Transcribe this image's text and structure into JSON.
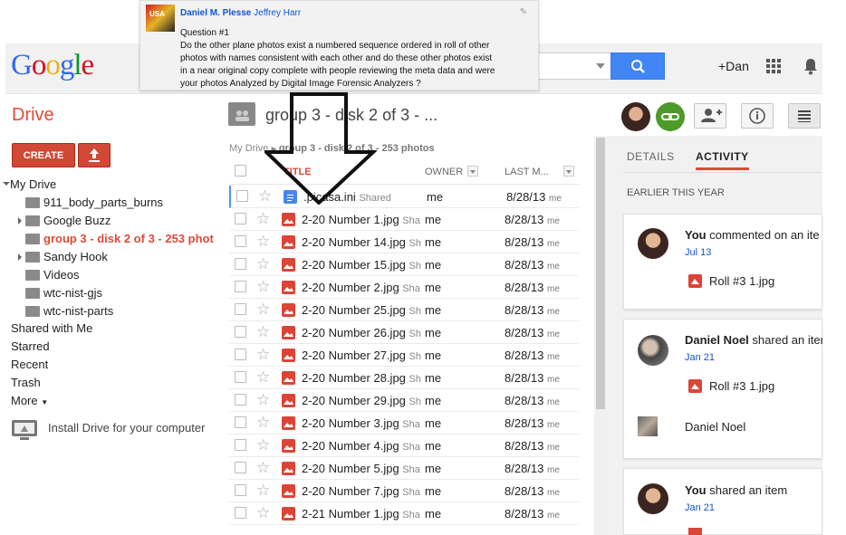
{
  "popup": {
    "author": "Daniel M. Plesse",
    "mention": "Jeffrey Harr",
    "lines": [
      "Question #1",
      "Do the other plane photos exist a numbered sequence ordered in roll of other",
      "photos with names consistent with each other and do these other photos exist",
      "in a near original copy complete with people reviewing the meta data and were",
      "your photos Analyzed by Digital Image Forensic Analyzers ?"
    ]
  },
  "header": {
    "logo_letters": [
      "G",
      "o",
      "o",
      "g",
      "l",
      "e"
    ],
    "logo_colors": [
      "#3369e8",
      "#d50f25",
      "#eeb211",
      "#3369e8",
      "#009925",
      "#d50f25"
    ],
    "user": "+Dan"
  },
  "drive": {
    "title": "Drive",
    "folder_title": "group 3 - disk 2 of 3 - ...",
    "create_label": "CREATE"
  },
  "nav": {
    "my_drive": "My Drive",
    "folders": [
      "911_body_parts_burns",
      "Google Buzz",
      "group 3 - disk 2 of 3 - 253 phot",
      "Sandy Hook",
      "Videos",
      "wtc-nist-gjs",
      "wtc-nist-parts"
    ],
    "shared": "Shared with Me",
    "starred": "Starred",
    "recent": "Recent",
    "trash": "Trash",
    "more": "More",
    "install": "Install Drive for your computer"
  },
  "list": {
    "breadcrumb_root": "My Drive",
    "breadcrumb_current": "group 3 - disk 2 of 3 - 253 photos",
    "col_title": "TITLE",
    "col_owner": "OWNER",
    "col_modified": "LAST M...",
    "rows": [
      {
        "name": ".picasa.ini",
        "shared": "Shared",
        "owner": "me",
        "date": "8/28/13",
        "by": "me",
        "type": "doc"
      },
      {
        "name": "2-20 Number 1.jpg",
        "shared": "Sha",
        "owner": "me",
        "date": "8/28/13",
        "by": "me",
        "type": "img"
      },
      {
        "name": "2-20 Number 14.jpg",
        "shared": "Sh",
        "owner": "me",
        "date": "8/28/13",
        "by": "me",
        "type": "img"
      },
      {
        "name": "2-20 Number 15.jpg",
        "shared": "Sh",
        "owner": "me",
        "date": "8/28/13",
        "by": "me",
        "type": "img"
      },
      {
        "name": "2-20 Number 2.jpg",
        "shared": "Sha",
        "owner": "me",
        "date": "8/28/13",
        "by": "me",
        "type": "img"
      },
      {
        "name": "2-20 Number 25.jpg",
        "shared": "Sh",
        "owner": "me",
        "date": "8/28/13",
        "by": "me",
        "type": "img"
      },
      {
        "name": "2-20 Number 26.jpg",
        "shared": "Sh",
        "owner": "me",
        "date": "8/28/13",
        "by": "me",
        "type": "img"
      },
      {
        "name": "2-20 Number 27.jpg",
        "shared": "Sh",
        "owner": "me",
        "date": "8/28/13",
        "by": "me",
        "type": "img"
      },
      {
        "name": "2-20 Number 28.jpg",
        "shared": "Sh",
        "owner": "me",
        "date": "8/28/13",
        "by": "me",
        "type": "img"
      },
      {
        "name": "2-20 Number 29.jpg",
        "shared": "Sh",
        "owner": "me",
        "date": "8/28/13",
        "by": "me",
        "type": "img"
      },
      {
        "name": "2-20 Number 3.jpg",
        "shared": "Sha",
        "owner": "me",
        "date": "8/28/13",
        "by": "me",
        "type": "img"
      },
      {
        "name": "2-20 Number 4.jpg",
        "shared": "Sha",
        "owner": "me",
        "date": "8/28/13",
        "by": "me",
        "type": "img"
      },
      {
        "name": "2-20 Number 5.jpg",
        "shared": "Sha",
        "owner": "me",
        "date": "8/28/13",
        "by": "me",
        "type": "img"
      },
      {
        "name": "2-20 Number 7.jpg",
        "shared": "Sha",
        "owner": "me",
        "date": "8/28/13",
        "by": "me",
        "type": "img"
      },
      {
        "name": "2-21 Number 1.jpg",
        "shared": "Sha",
        "owner": "me",
        "date": "8/28/13",
        "by": "me",
        "type": "img"
      }
    ]
  },
  "panel": {
    "tab_details": "DETAILS",
    "tab_activity": "ACTIVITY",
    "section": "EARLIER THIS YEAR",
    "cards": [
      {
        "who": "You",
        "action": "commented on an ite",
        "date": "Jul 13",
        "file": "Roll #3 1.jpg"
      },
      {
        "who": "Daniel Noel",
        "action": "shared an iter",
        "date": "Jan 21",
        "file": "Roll #3 1.jpg",
        "person": "Daniel Noel"
      },
      {
        "who": "You",
        "action": "shared an item",
        "date": "Jan 21"
      }
    ]
  },
  "colors": {
    "drive_red": "#dd4b39",
    "create_red": "#d14836",
    "search_blue": "#4285f4",
    "link_blue": "#1155cc"
  }
}
